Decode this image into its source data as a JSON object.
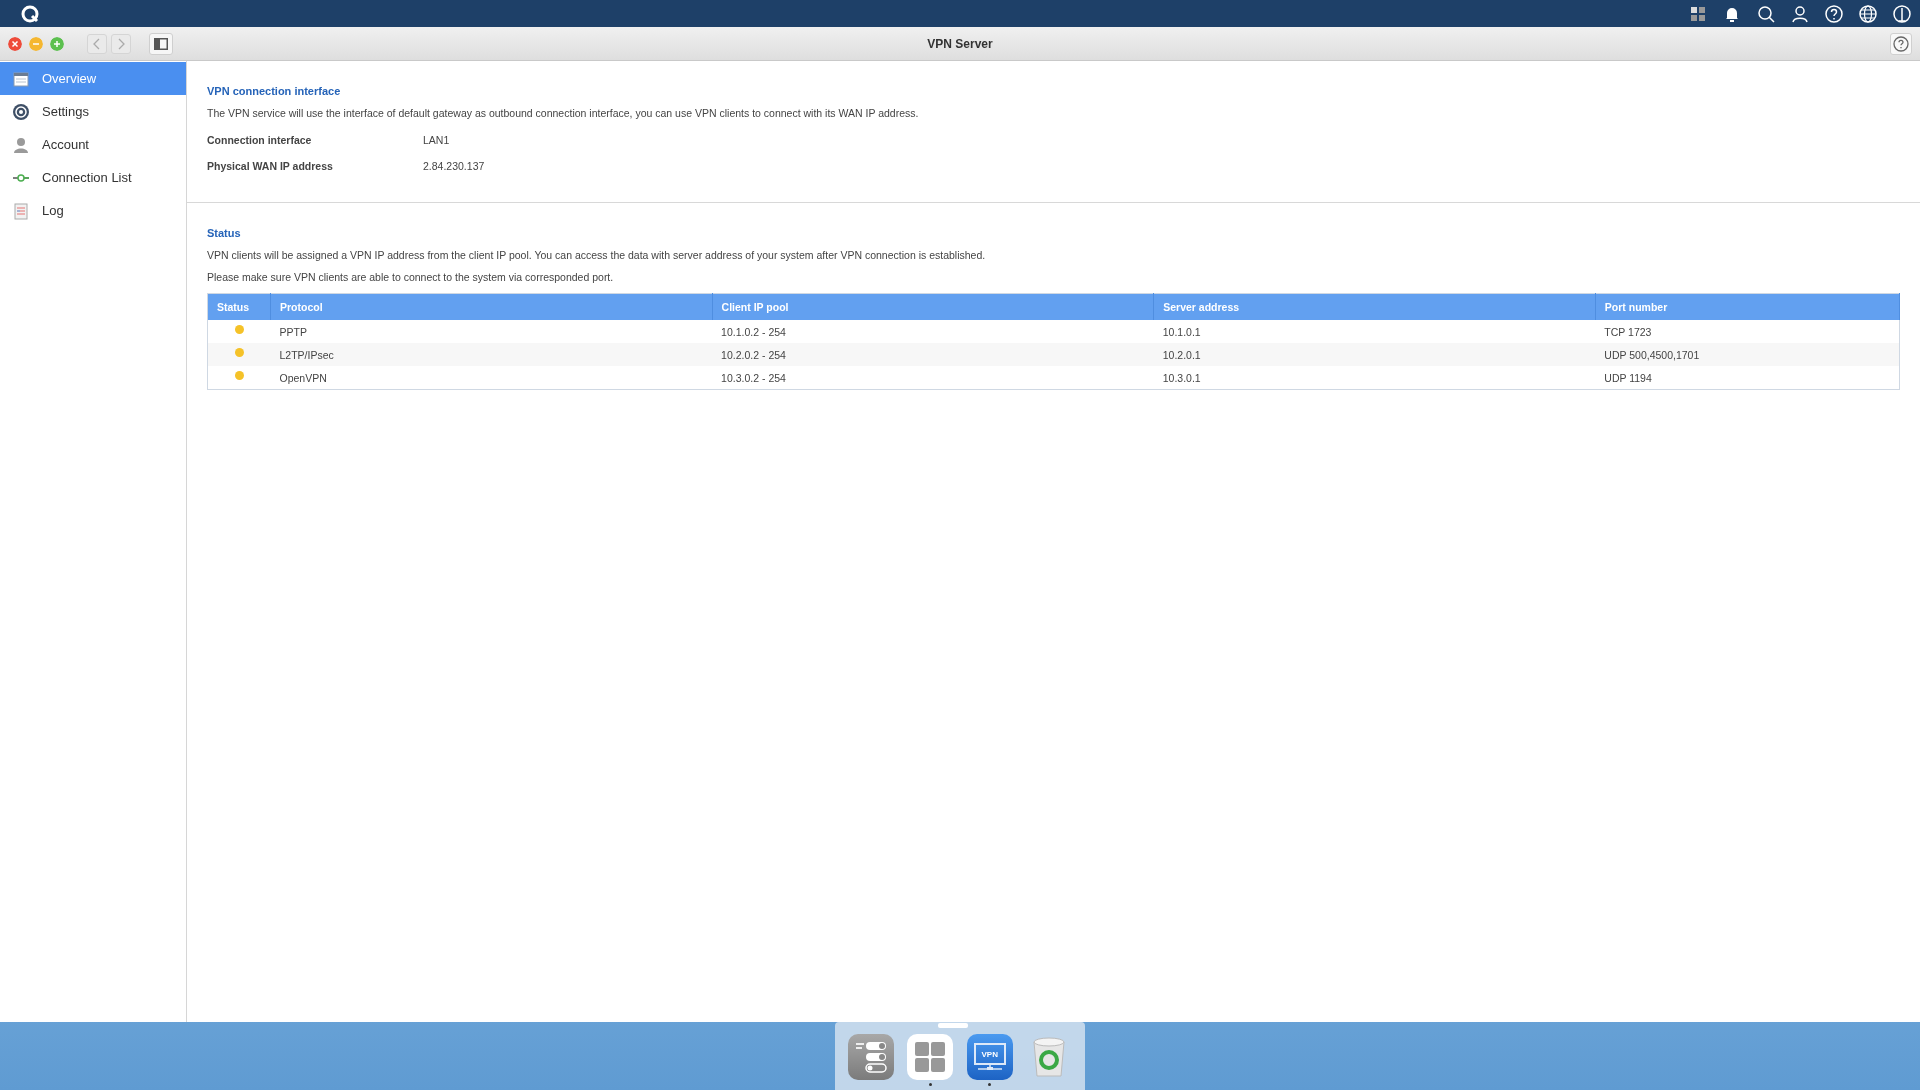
{
  "window": {
    "title": "VPN Server"
  },
  "sidebar": {
    "items": [
      {
        "label": "Overview",
        "kind": "overview",
        "selected": true
      },
      {
        "label": "Settings",
        "kind": "settings",
        "selected": false
      },
      {
        "label": "Account",
        "kind": "account",
        "selected": false
      },
      {
        "label": "Connection List",
        "kind": "connection",
        "selected": false
      },
      {
        "label": "Log",
        "kind": "log",
        "selected": false
      }
    ]
  },
  "interface_section": {
    "title": "VPN connection interface",
    "description": "The VPN service will use the interface of default gateway as outbound connection interface, you can use VPN clients to connect with its WAN IP address.",
    "fields": [
      {
        "label": "Connection interface",
        "value": "LAN1"
      },
      {
        "label": "Physical WAN IP address",
        "value": "2.84.230.137"
      }
    ]
  },
  "status_section": {
    "title": "Status",
    "paragraphs": [
      "VPN clients will be assigned a VPN IP address from the client IP pool. You can access the data with server address of your system after VPN connection is established.",
      "Please make sure VPN clients are able to connect to the system via corresponded port."
    ],
    "table": {
      "columns": [
        "Status",
        "Protocol",
        "Client IP pool",
        "Server address",
        "Port number"
      ],
      "rows": [
        {
          "color": "#f5c228",
          "protocol": "PPTP",
          "client_ip_pool": "10.1.0.2 - 254",
          "server_address": "10.1.0.1",
          "port_number": "TCP 1723"
        },
        {
          "color": "#f5c228",
          "protocol": "L2TP/IPsec",
          "client_ip_pool": "10.2.0.2 - 254",
          "server_address": "10.2.0.1",
          "port_number": "UDP 500,4500,1701"
        },
        {
          "color": "#f5c228",
          "protocol": "OpenVPN",
          "client_ip_pool": "10.3.0.2 - 254",
          "server_address": "10.3.0.1",
          "port_number": "UDP 1194"
        }
      ]
    }
  },
  "dock": {
    "items": [
      {
        "kind": "control",
        "running": false
      },
      {
        "kind": "apps",
        "running": true
      },
      {
        "kind": "vpn",
        "label": "VPN",
        "running": true
      },
      {
        "kind": "trash",
        "running": false
      }
    ]
  }
}
